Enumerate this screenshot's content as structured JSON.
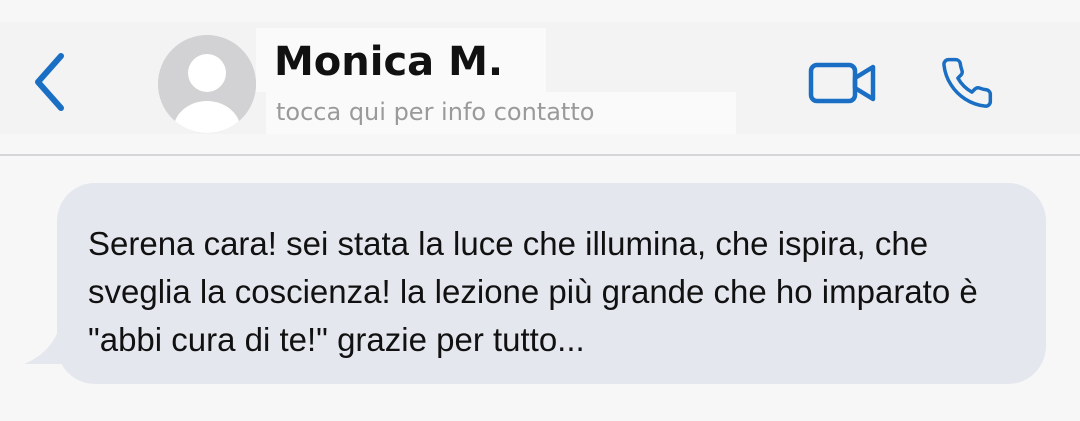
{
  "header": {
    "contact_name": "Monica M.",
    "contact_subtitle": "tocca qui per info contatto",
    "icons": {
      "back": "chevron-left-icon",
      "avatar": "person-avatar-icon",
      "video": "video-camera-icon",
      "call": "phone-icon"
    },
    "accent_color": "#1a6fc4"
  },
  "messages": [
    {
      "direction": "incoming",
      "text": "Serena cara! sei stata la luce che illumina, che ispira, che sveglia la coscienza! la lezione più grande che ho imparato è \"abbi cura di te!\" grazie per tutto...",
      "bubble_color": "#e5e7ef"
    }
  ]
}
